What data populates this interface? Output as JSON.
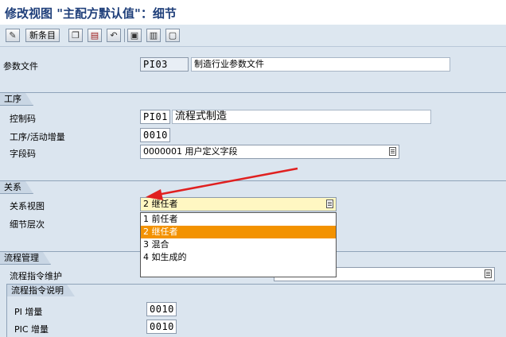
{
  "window": {
    "title": "修改视图 \"主配方默认值\"：细节"
  },
  "toolbar": {
    "new_entries_label": "新条目",
    "icons": [
      "edit-toggle-icon",
      "copy-icon",
      "delete-icon",
      "undo-icon",
      "select-all-icon",
      "select-block-icon",
      "deselect-all-icon"
    ]
  },
  "header": {
    "profile_label": "参数文件",
    "profile_value": "PI03",
    "profile_desc": "制造行业参数文件"
  },
  "operations": {
    "section_title": "工序",
    "control_key_label": "控制码",
    "control_key_value": "PI01",
    "control_key_desc": "流程式制造",
    "op_increment_label": "工序/活动增量",
    "op_increment_value": "0010",
    "field_key_label": "字段码",
    "field_key_value": "0000001 用户定义字段"
  },
  "relations": {
    "section_title": "关系",
    "relation_view_label": "关系视图",
    "relation_view_value": "2 继任者",
    "detail_level_label": "细节层次",
    "options": [
      {
        "label": "1 前任者",
        "selected": false
      },
      {
        "label": "2 继任者",
        "selected": true
      },
      {
        "label": "3 混合",
        "selected": false
      },
      {
        "label": "4 如生成的",
        "selected": false
      }
    ]
  },
  "process_mgmt": {
    "section_title": "流程管理",
    "maintain_label": "流程指令维护",
    "pi_desc_title": "流程指令说明",
    "pi_increment_label": "PI 增量",
    "pi_increment_value": "0010",
    "pic_increment_label": "PIC 增量",
    "pic_increment_value": "0010"
  },
  "colors": {
    "selected_option": "#f39200",
    "annotation_arrow": "#e02020",
    "title_text": "#1f3f7a",
    "active_field": "#fff7c2"
  }
}
